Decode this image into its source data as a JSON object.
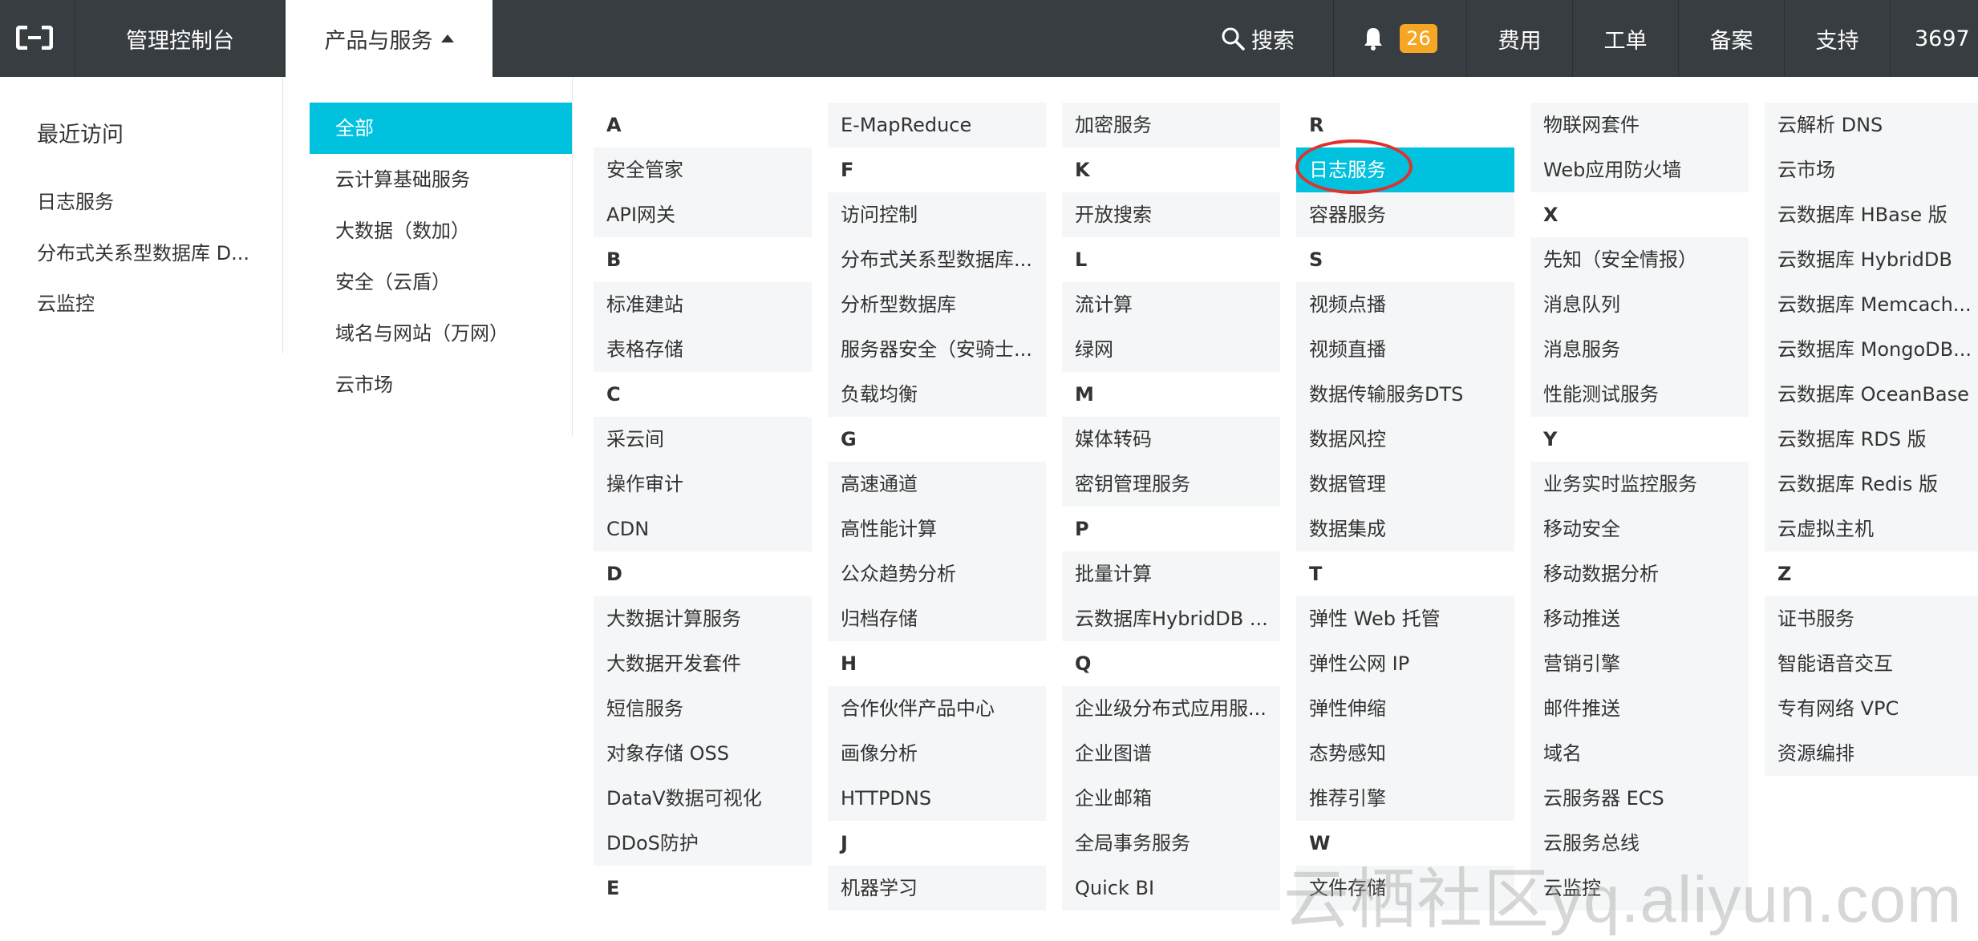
{
  "topbar": {
    "console": "管理控制台",
    "products": "产品与服务",
    "search": "搜索",
    "badge": "26",
    "fee": "费用",
    "ticket": "工单",
    "record": "备案",
    "support": "支持",
    "user": "3697"
  },
  "recent": {
    "title": "最近访问",
    "items": [
      "日志服务",
      "分布式关系型数据库 D...",
      "云监控"
    ]
  },
  "categories": [
    "全部",
    "云计算基础服务",
    "大数据（数加）",
    "安全（云盾）",
    "域名与网站（万网）",
    "云市场"
  ],
  "columns": [
    [
      "A",
      "安全管家",
      "API网关",
      "B",
      "标准建站",
      "表格存储",
      "C",
      "采云间",
      "操作审计",
      "CDN",
      "D",
      "大数据计算服务",
      "大数据开发套件",
      "短信服务",
      "对象存储 OSS",
      "DataV数据可视化",
      "DDoS防护",
      "E"
    ],
    [
      "E-MapReduce",
      "F",
      "访问控制",
      "分布式关系型数据库...",
      "分析型数据库",
      "服务器安全（安骑士...",
      "负载均衡",
      "G",
      "高速通道",
      "高性能计算",
      "公众趋势分析",
      "归档存储",
      "H",
      "合作伙伴产品中心",
      "画像分析",
      "HTTPDNS",
      "J",
      "机器学习"
    ],
    [
      "加密服务",
      "K",
      "开放搜索",
      "L",
      "流计算",
      "绿网",
      "M",
      "媒体转码",
      "密钥管理服务",
      "P",
      "批量计算",
      "云数据库HybridDB ...",
      "Q",
      "企业级分布式应用服...",
      "企业图谱",
      "企业邮箱",
      "全局事务服务",
      "Quick BI"
    ],
    [
      "R",
      "日志服务",
      "容器服务",
      "S",
      "视频点播",
      "视频直播",
      "数据传输服务DTS",
      "数据风控",
      "数据管理",
      "数据集成",
      "T",
      "弹性 Web 托管",
      "弹性公网 IP",
      "弹性伸缩",
      "态势感知",
      "推荐引擎",
      "W",
      "文件存储"
    ],
    [
      "物联网套件",
      "Web应用防火墙",
      "X",
      "先知（安全情报）",
      "消息队列",
      "消息服务",
      "性能测试服务",
      "Y",
      "业务实时监控服务",
      "移动安全",
      "移动数据分析",
      "移动推送",
      "营销引擎",
      "邮件推送",
      "域名",
      "云服务器 ECS",
      "云服务总线",
      "云监控"
    ],
    [
      "云解析 DNS",
      "云市场",
      "云数据库 HBase 版",
      "云数据库 HybridDB",
      "云数据库 Memcach...",
      "云数据库 MongoDB...",
      "云数据库 OceanBase",
      "云数据库 RDS 版",
      "云数据库 Redis 版",
      "云虚拟主机",
      "Z",
      "证书服务",
      "智能语音交互",
      "专有网络 VPC",
      "资源编排"
    ]
  ],
  "letters": [
    "A",
    "B",
    "C",
    "D",
    "E",
    "F",
    "G",
    "H",
    "J",
    "K",
    "L",
    "M",
    "P",
    "Q",
    "R",
    "S",
    "T",
    "W",
    "X",
    "Y",
    "Z"
  ],
  "highlighted": "日志服务",
  "watermark": "云栖社区yq.aliyun.com",
  "colors": {
    "topbar": "#373d41",
    "accent": "#00c1de",
    "badge": "#f5a623",
    "ring": "#e0312b"
  }
}
